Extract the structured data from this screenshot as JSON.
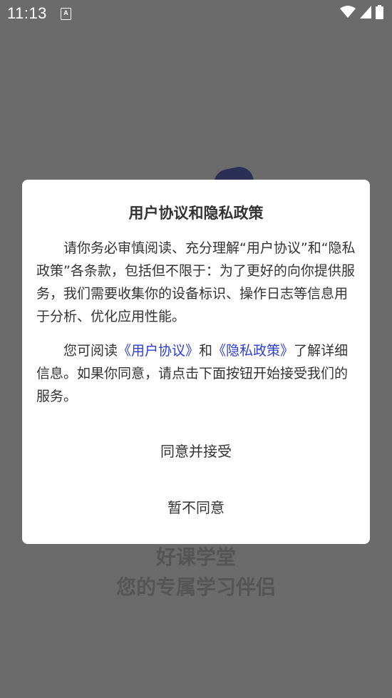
{
  "status_bar": {
    "time": "11:13",
    "notification_icon": "font-a-icon",
    "wifi_icon": "wifi-icon",
    "signal_icon": "cell-signal-icon",
    "battery_icon": "battery-icon"
  },
  "splash": {
    "app_name": "好课学堂",
    "slogan": "您的专属学习伴侣"
  },
  "dialog": {
    "title": "用户协议和隐私政策",
    "paragraph1": "请你务必审慎阅读、充分理解“用户协议”和“隐私政策”各条款，包括但不限于：为了更好的向你提供服务，我们需要收集你的设备标识、操作日志等信息用于分析、优化应用性能。",
    "paragraph2_prefix": "您可阅读",
    "user_agreement_link": "《用户协议》",
    "paragraph2_and": "和",
    "privacy_policy_link": "《隐私政策》",
    "paragraph2_suffix": "了解详细信息。如果你同意，请点击下面按钮开始接受我们的服务。",
    "agree_button": "同意并接受",
    "disagree_button": "暂不同意"
  },
  "colors": {
    "overlay": "#6b6b6b",
    "link": "#2b3dd6",
    "text": "#333333"
  }
}
